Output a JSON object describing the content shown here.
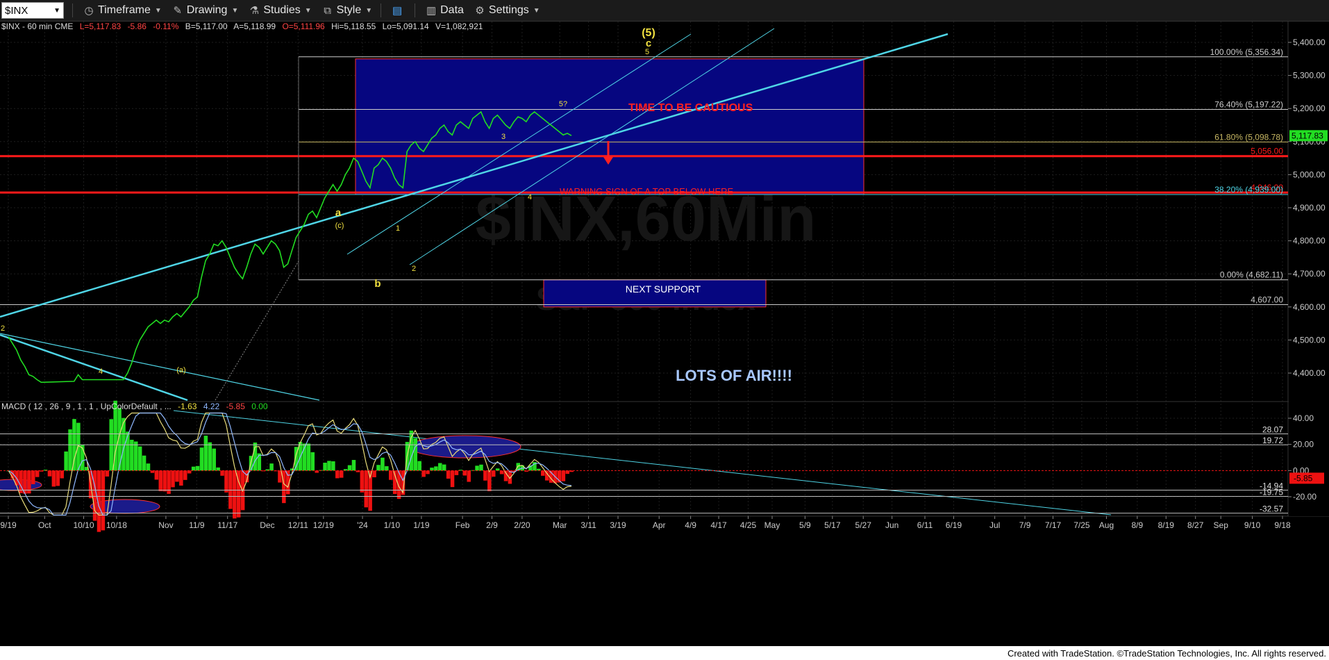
{
  "toolbar": {
    "symbol": "$INX",
    "items": [
      {
        "label": "Timeframe",
        "icon": "clock-icon"
      },
      {
        "label": "Drawing",
        "icon": "pencil-icon"
      },
      {
        "label": "Studies",
        "icon": "flask-icon"
      },
      {
        "label": "Style",
        "icon": "style-icon"
      },
      {
        "label": "",
        "icon": "layout-icon"
      },
      {
        "label": "Data",
        "icon": "bar-chart-icon"
      },
      {
        "label": "Settings",
        "icon": "gear-icon"
      }
    ]
  },
  "header": {
    "symbol_info": "$INX - 60 min  CME",
    "last": "L=5,117.83",
    "change": "-5.86",
    "pct": "-0.11%",
    "bid": "B=5,117.00",
    "ask": "A=5,118.99",
    "open": "O=5,111.96",
    "high": "Hi=5,118.55",
    "low": "Lo=5,091.14",
    "volume": "V=1,082,921"
  },
  "watermark": {
    "line1": "$INX,60Min",
    "line2": "S&P 500 Index"
  },
  "colors": {
    "price": "#22dd22",
    "cyan": "#4fd5e6",
    "red_line": "#ff1a1a",
    "box_fill": "#060680",
    "yellow_label": "#f0e040",
    "macd_up": "#22dd22",
    "macd_down": "#ee1111",
    "macd_line": "#e8dc7a",
    "signal_line": "#8fb8ff"
  },
  "chart_data": {
    "type": "line",
    "title": "",
    "price_axis": {
      "ticks": [
        4400,
        4500,
        4600,
        4700,
        4800,
        4900,
        5000,
        5100,
        5200,
        5300,
        5400
      ],
      "tick_labels": [
        "4,400.00",
        "4,500.00",
        "4,600.00",
        "4,700.00",
        "4,800.00",
        "4,900.00",
        "5,000.00",
        "5,100.00",
        "5,200.00",
        "5,300.00",
        "5,400.00"
      ],
      "ylim": [
        4355,
        5455
      ],
      "current_label": "5,117.83",
      "current": 5117.83
    },
    "macd_axis": {
      "ticks": [
        40,
        20,
        0,
        -20
      ],
      "tick_labels": [
        "40.00",
        "20.00",
        "0.00",
        "-20.00"
      ],
      "ylim": [
        -36,
        46
      ],
      "levels": [
        {
          "value": 28.07,
          "label": "28.07"
        },
        {
          "value": 19.72,
          "label": "19.72"
        },
        {
          "value": -14.94,
          "label": "-14.94"
        },
        {
          "value": -19.75,
          "label": "-19.75"
        },
        {
          "value": -32.57,
          "label": "-32.57"
        }
      ],
      "current_label": "-5.85",
      "current": -5.85
    },
    "x_axis": {
      "tick_labels": [
        "9/19",
        "Oct",
        "10/10",
        "10/18",
        "Nov",
        "11/9",
        "11/17",
        "Dec",
        "12/11",
        "12/19",
        "'24",
        "1/10",
        "1/19",
        "Feb",
        "2/9",
        "2/20",
        "Mar",
        "3/11",
        "3/19",
        "Apr",
        "4/9",
        "4/17",
        "4/25",
        "May",
        "5/9",
        "5/17",
        "5/27",
        "Jun",
        "6/11",
        "6/19",
        "Jul",
        "7/9",
        "7/17",
        "7/25",
        "Aug",
        "8/9",
        "8/19",
        "8/27",
        "Sep",
        "9/10",
        "9/18"
      ],
      "tick_pos": [
        0,
        5.3,
        11,
        15.8,
        23,
        27.5,
        32,
        37.8,
        42.3,
        46,
        51.7,
        56,
        60.3,
        66.3,
        70.6,
        75,
        80.5,
        84.7,
        89,
        95,
        99.6,
        103.7,
        108,
        111.5,
        116.3,
        120.3,
        124.8,
        129,
        133.8,
        138,
        144,
        148.4,
        152.5,
        156.7,
        160.3,
        164.8,
        169,
        173.3,
        177,
        181.6,
        186
      ]
    },
    "price_series": {
      "name": "",
      "x": [
        0,
        0.6,
        1.2,
        1.8,
        2.4,
        3,
        3.6,
        4.2,
        4.8,
        5.4,
        6,
        6.6,
        7.2,
        7.8,
        8.4,
        9,
        9.6,
        10.2,
        10.8,
        11.4,
        12,
        12.6,
        13.2,
        13.8,
        14.4,
        15,
        15.6,
        16.2,
        16.8,
        17.4,
        18,
        18.6,
        19.2,
        19.8,
        20.4,
        21,
        21.6,
        22.2,
        22.8,
        23.4,
        24,
        24.6,
        25.2,
        25.8,
        26.4,
        27,
        27.6,
        28.2,
        28.8,
        29.4,
        30,
        30.6,
        31.2,
        31.8,
        32.4,
        33,
        33.6,
        34.2,
        34.8,
        35.4,
        36,
        36.6,
        37.2,
        37.8,
        38.4,
        39,
        39.6,
        40.2,
        40.8,
        41.4,
        42,
        42.6,
        43.2,
        43.8,
        44.4,
        45,
        45.6,
        46.2,
        46.8,
        47.4,
        48,
        48.6,
        49.2,
        49.8,
        50.4,
        51,
        51.6,
        52.2,
        52.8,
        53.4,
        54,
        54.6,
        55.2,
        55.8,
        56.4,
        57,
        57.6,
        58.2,
        58.8,
        59.4,
        60,
        60.6,
        61.2,
        61.8,
        62.4,
        63,
        63.6,
        64.2,
        64.8,
        65.4,
        66,
        66.6,
        67.2,
        67.8,
        68.4,
        69,
        69.6,
        70.2,
        70.8,
        71.4,
        72,
        72.6,
        73.2,
        73.8,
        74.4,
        75,
        75.6,
        76.2,
        76.8,
        77.4,
        78,
        78.6,
        79.2,
        79.8,
        80.4,
        81,
        81.6,
        82.2,
        82.8,
        83.4,
        84,
        84.6,
        85.2
      ],
      "values": [
        4510,
        4490,
        4470,
        4440,
        4420,
        4395,
        4390,
        4380,
        4372,
        4360,
        4330,
        4290,
        4270,
        4260,
        4300,
        4340,
        4375,
        4395,
        4380,
        4360,
        4300,
        4240,
        4180,
        4130,
        4200,
        4290,
        4330,
        4350,
        4380,
        4400,
        4430,
        4470,
        4500,
        4520,
        4540,
        4550,
        4560,
        4550,
        4560,
        4555,
        4570,
        4580,
        4570,
        4585,
        4600,
        4620,
        4630,
        4690,
        4740,
        4760,
        4790,
        4785,
        4800,
        4780,
        4750,
        4720,
        4700,
        4685,
        4720,
        4760,
        4790,
        4780,
        4760,
        4780,
        4800,
        4790,
        4770,
        4720,
        4730,
        4770,
        4810,
        4830,
        4850,
        4880,
        4890,
        4870,
        4900,
        4930,
        4950,
        4970,
        4950,
        4970,
        5000,
        5020,
        5050,
        5040,
        5010,
        4980,
        4960,
        5020,
        5030,
        5050,
        5040,
        5020,
        4990,
        4970,
        4960,
        5070,
        5090,
        5100,
        5080,
        5070,
        5090,
        5110,
        5120,
        5140,
        5150,
        5130,
        5120,
        5150,
        5160,
        5150,
        5140,
        5170,
        5180,
        5190,
        5160,
        5140,
        5170,
        5180,
        5165,
        5150,
        5140,
        5160,
        5175,
        5170,
        5160,
        5180,
        5190,
        5180,
        5170,
        5160,
        5150,
        5140,
        5130,
        5120,
        5125,
        5118
      ],
      "x_offset": 0
    },
    "levels": [
      {
        "value": 5356.34,
        "label": "100.00% (5,356.34)",
        "color": "#cccccc"
      },
      {
        "value": 5197.22,
        "label": "76.40% (5,197.22)",
        "color": "#cccccc"
      },
      {
        "value": 5098.78,
        "label": "61.80% (5,098.78)",
        "color": "#c8b864"
      },
      {
        "value": 5056.0,
        "label": "5,056.00",
        "color": "#ff1a1a",
        "thick": true
      },
      {
        "value": 4946.0,
        "label": "4,946.00",
        "color": "#ff1a1a",
        "thick": true
      },
      {
        "value": 4940.0,
        "label": "38.20% (4,939.00)",
        "color": "#4fd5e6"
      },
      {
        "value": 4682.11,
        "label": "0.00% (4,682.11)",
        "color": "#cccccc"
      },
      {
        "value": 4607.0,
        "label": "4,607.00",
        "color": "#cccccc"
      }
    ],
    "annotations": {
      "caution": "TIME TO BE CAUTIOUS",
      "warning": "WARNING SIGN OF A TOP BELOW HERE",
      "support": "NEXT SUPPORT",
      "air": "LOTS OF AIR!!!!",
      "wave_labels": [
        "(5)",
        "c",
        "5",
        "5?",
        "3",
        "4",
        "a",
        "(c)",
        "b",
        "1",
        "2",
        "2",
        "4",
        "(a)"
      ]
    },
    "macd_label": "MACD ( 12 , 26 , 9 , 1 , 1 , UpColorDefault , ...",
    "macd_values": [
      "-1.63",
      "4.22",
      "-5.85",
      "0.00"
    ],
    "grid": true,
    "legend": "none"
  },
  "footer": {
    "credit": "Created with TradeStation. ©TradeStation Technologies, Inc. All rights reserved."
  }
}
